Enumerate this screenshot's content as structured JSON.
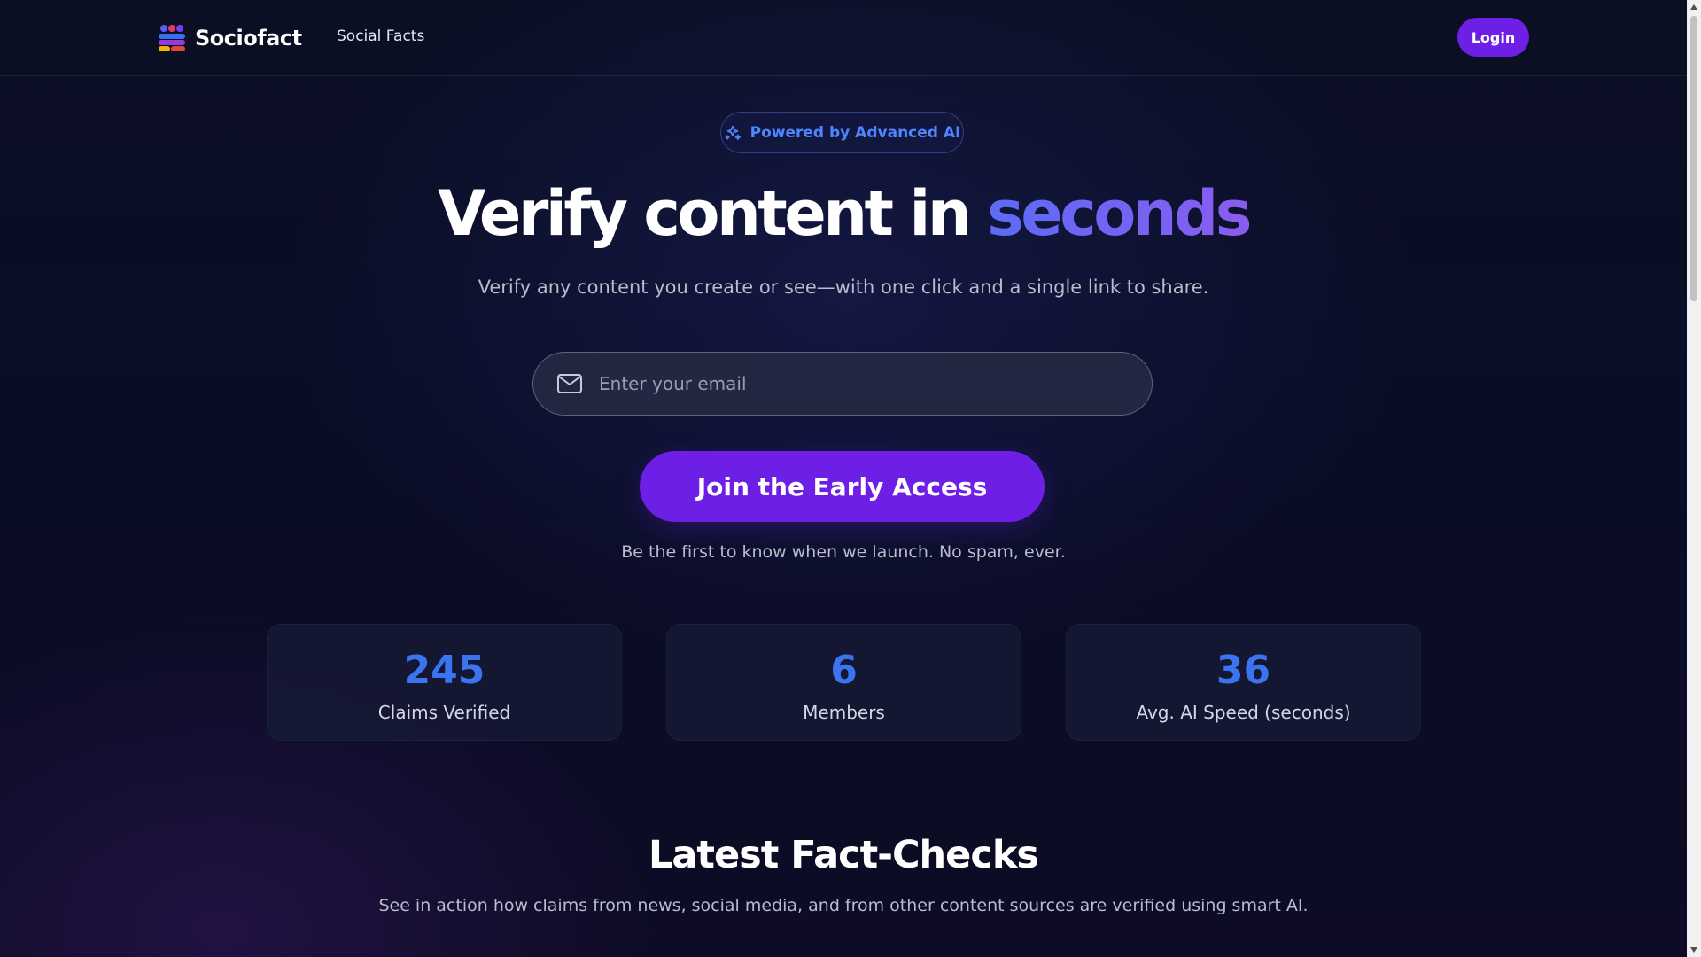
{
  "app": {
    "brand": "Sociofact",
    "nav_link": "Social Facts",
    "login_label": "Login"
  },
  "hero": {
    "badge": "Powered by Advanced AI",
    "title_main": "Verify content in ",
    "title_accent": "seconds",
    "subtitle": "Verify any content you create or see—with one click and a single link to share.",
    "email_placeholder": "Enter your email",
    "cta_label": "Join the Early Access",
    "note": "Be the first to know when we launch. No spam, ever."
  },
  "stats": [
    {
      "value": "245",
      "label": "Claims Verified"
    },
    {
      "value": "6",
      "label": "Members"
    },
    {
      "value": "36",
      "label": "Avg. AI Speed (seconds)"
    }
  ],
  "section": {
    "title": "Latest Fact-Checks",
    "subtitle": "See in action how claims from news, social media, and from other content sources are verified using smart AI."
  },
  "colors": {
    "accent": "#6d1fe6",
    "stat_value": "#3b74f0",
    "badge_text": "#4f86ff"
  },
  "icons": {
    "logo": "sociofact-logo-icon",
    "badge": "sparkle-icon",
    "email": "mail-icon"
  }
}
